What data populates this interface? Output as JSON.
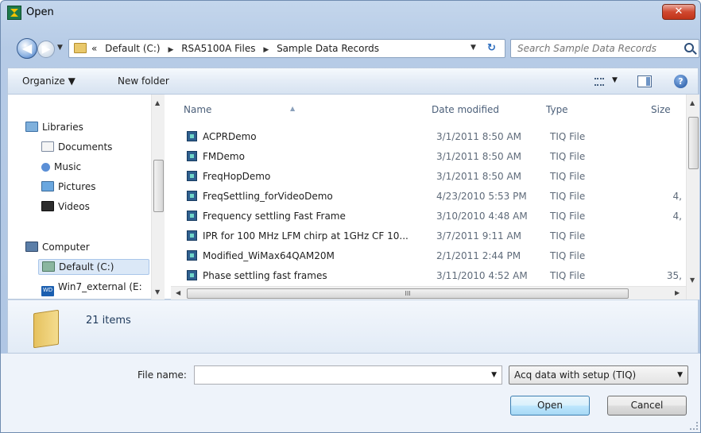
{
  "window": {
    "title": "Open",
    "close_glyph": "✕"
  },
  "nav": {
    "back_glyph": "◀",
    "forward_glyph": "▶",
    "breadcrumb_prefix": "«",
    "breadcrumbs": [
      "Default (C:)",
      "RSA5100A Files",
      "Sample Data Records"
    ],
    "search_placeholder": "Search Sample Data Records"
  },
  "toolbar": {
    "organize_label": "Organize ▼",
    "new_folder_label": "New folder"
  },
  "sidebar": {
    "items": [
      {
        "label": "Libraries",
        "icon": "libraries-icon"
      },
      {
        "label": "Documents",
        "icon": "documents-icon"
      },
      {
        "label": "Music",
        "icon": "music-icon"
      },
      {
        "label": "Pictures",
        "icon": "pictures-icon"
      },
      {
        "label": "Videos",
        "icon": "videos-icon"
      },
      {
        "label": "Computer",
        "icon": "computer-icon"
      },
      {
        "label": "Default (C:)",
        "icon": "drive-icon",
        "selected": true
      },
      {
        "label": "Win7_external (E:",
        "icon": "wd-drive-icon"
      }
    ]
  },
  "files": {
    "columns": {
      "name": "Name",
      "date": "Date modified",
      "type": "Type",
      "size": "Size"
    },
    "rows": [
      {
        "name": "ACPRDemo",
        "date": "3/1/2011 8:50 AM",
        "type": "TIQ File",
        "size": ""
      },
      {
        "name": "FMDemo",
        "date": "3/1/2011 8:50 AM",
        "type": "TIQ File",
        "size": ""
      },
      {
        "name": "FreqHopDemo",
        "date": "3/1/2011 8:50 AM",
        "type": "TIQ File",
        "size": ""
      },
      {
        "name": "FreqSettling_forVideoDemo",
        "date": "4/23/2010 5:53 PM",
        "type": "TIQ File",
        "size": "4,"
      },
      {
        "name": "Frequency settling Fast Frame",
        "date": "3/10/2010 4:48 AM",
        "type": "TIQ File",
        "size": "4,"
      },
      {
        "name": "IPR for 100 MHz LFM chirp at 1GHz CF 10...",
        "date": "3/7/2011 9:11 AM",
        "type": "TIQ File",
        "size": ""
      },
      {
        "name": "Modified_WiMax64QAM20M",
        "date": "2/1/2011 2:44 PM",
        "type": "TIQ File",
        "size": ""
      },
      {
        "name": "Phase settling fast frames",
        "date": "3/11/2010 4:52 AM",
        "type": "TIQ File",
        "size": "35,"
      }
    ]
  },
  "details": {
    "item_count": "21 items"
  },
  "footer": {
    "file_name_label": "File name:",
    "file_name_value": "",
    "file_type_filter": "Acq data with setup (TIQ)",
    "open_label": "Open",
    "cancel_label": "Cancel"
  },
  "colors": {
    "accent": "#2f66b8",
    "window_frame": "#b6cbe6",
    "close_red": "#c03419"
  }
}
